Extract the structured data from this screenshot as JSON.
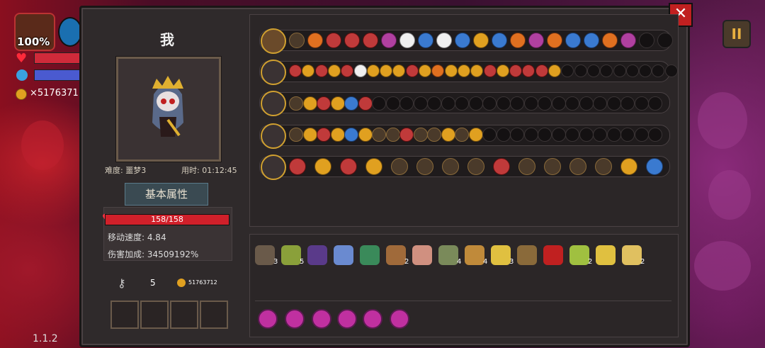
{
  "hud": {
    "health_percent": "100%",
    "coins": "×5176371",
    "version": "1.1.2"
  },
  "player": {
    "name": "我",
    "difficulty": "难度: 噩梦3",
    "time": "用时: 01:12:45"
  },
  "tab": {
    "basic_attributes": "基本属性"
  },
  "stats": {
    "hp": "158/158",
    "move_speed": "移动速度: 4.84",
    "damage_bonus": "伤害加成: 34509192%"
  },
  "inventory": {
    "keys": "5",
    "gold": "51763712"
  },
  "items": [
    {
      "icon": "hat-icon",
      "count": "3"
    },
    {
      "icon": "scroll-icon",
      "count": "5"
    },
    {
      "icon": "book-icon",
      "count": ""
    },
    {
      "icon": "crystal-icon",
      "count": ""
    },
    {
      "icon": "helmet-icon",
      "count": ""
    },
    {
      "icon": "tooth-icon",
      "count": "2"
    },
    {
      "icon": "egg-icon",
      "count": ""
    },
    {
      "icon": "sword-icon",
      "count": "4"
    },
    {
      "icon": "pickaxe-icon",
      "count": "4"
    },
    {
      "icon": "flask-icon",
      "count": "3"
    },
    {
      "icon": "hourglass-icon",
      "count": ""
    },
    {
      "icon": "eye-icon",
      "count": ""
    },
    {
      "icon": "wing-icon",
      "count": "2"
    },
    {
      "icon": "antler-icon",
      "count": ""
    },
    {
      "icon": "fang-icon",
      "count": "2"
    }
  ],
  "colors": {
    "accent": "#d0a030",
    "hp": "#d0202a",
    "panel": "#2f2a2b"
  }
}
